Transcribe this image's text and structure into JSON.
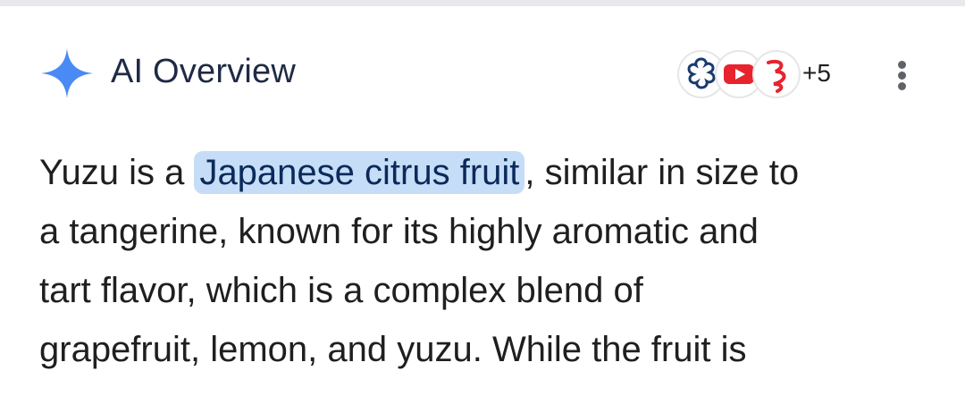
{
  "header": {
    "title": "AI Overview",
    "more_sources_label": "+5",
    "icons": [
      "sparkle-icon",
      "source-favicon-1",
      "source-favicon-youtube",
      "source-favicon-3",
      "more-vert-icon"
    ]
  },
  "overview": {
    "line1_before": "Yuzu is a ",
    "line1_link": "Japanese citrus fruit",
    "line1_after": ", similar in size to",
    "line2": "a tangerine, known for its highly aromatic and",
    "line3": "tart flavor, which is a complex blend of",
    "line4": "grapefruit, lemon, and yuzu. While the fruit is"
  },
  "colors": {
    "sparkle": "#4a8af4",
    "highlight_bg": "#c6ddf8",
    "title": "#1f2a44",
    "youtube_red": "#e8232d"
  }
}
